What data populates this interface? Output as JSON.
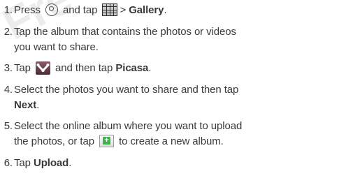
{
  "watermark": "Fre",
  "steps": [
    {
      "number": "1.",
      "parts": [
        "Press",
        "and tap",
        ">",
        "Gallery",
        "."
      ]
    },
    {
      "number": "2.",
      "line1": "Tap the album that contains the photos or videos",
      "line2": "you want to share."
    },
    {
      "number": "3.",
      "parts": [
        "Tap",
        "and then tap",
        "Picasa",
        "."
      ]
    },
    {
      "number": "4.",
      "line1": "Select the photos you want to share and then tap",
      "bold": "Next",
      "end": "."
    },
    {
      "number": "5.",
      "line1": "Select the online album where you want to upload",
      "line2a": "the photos, or tap",
      "line2b": "to create a new album."
    },
    {
      "number": "6.",
      "parts": [
        "Tap",
        "Upload",
        "."
      ]
    }
  ],
  "icons": {
    "home": "home-icon",
    "all_apps": "all-apps-grid-icon",
    "share": "share-icon",
    "add": "add-plus-icon"
  }
}
